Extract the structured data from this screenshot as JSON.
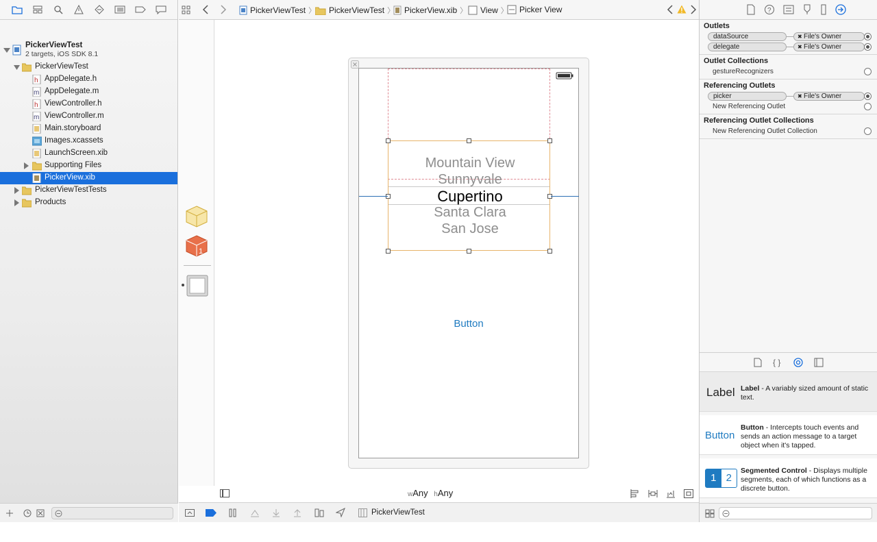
{
  "navigator": {
    "project_name": "PickerViewTest",
    "project_subtitle": "2 targets, iOS SDK 8.1",
    "items": [
      {
        "label": "PickerViewTest"
      },
      {
        "label": "AppDelegate.h"
      },
      {
        "label": "AppDelegate.m"
      },
      {
        "label": "ViewController.h"
      },
      {
        "label": "ViewController.m"
      },
      {
        "label": "Main.storyboard"
      },
      {
        "label": "Images.xcassets"
      },
      {
        "label": "LaunchScreen.xib"
      },
      {
        "label": "Supporting Files"
      },
      {
        "label": "PickerView.xib"
      },
      {
        "label": "PickerViewTestTests"
      },
      {
        "label": "Products"
      }
    ]
  },
  "jumpbar": {
    "crumbs": [
      "PickerViewTest",
      "PickerViewTest",
      "PickerView.xib",
      "View",
      "Picker View"
    ]
  },
  "canvas": {
    "picker_rows": [
      "Mountain View",
      "Sunnyvale",
      "Cupertino",
      "Santa Clara",
      "San Jose"
    ],
    "button_label": "Button",
    "size_class_w_prefix": "w",
    "size_class_w": "Any",
    "size_class_h_prefix": "h",
    "size_class_h": "Any",
    "selected_index": 2
  },
  "debug": {
    "scheme_label": "PickerViewTest"
  },
  "inspector": {
    "outlets_title": "Outlets",
    "outlets": [
      {
        "name": "dataSource",
        "target": "File's Owner"
      },
      {
        "name": "delegate",
        "target": "File's Owner"
      }
    ],
    "outlet_collections_title": "Outlet Collections",
    "outlet_collections": [
      {
        "name": "gestureRecognizers"
      }
    ],
    "referencing_outlets_title": "Referencing Outlets",
    "referencing_outlets": [
      {
        "name": "picker",
        "target": "File's Owner"
      }
    ],
    "new_referencing_outlet": "New Referencing Outlet",
    "referencing_collections_title": "Referencing Outlet Collections",
    "new_referencing_collection": "New Referencing Outlet Collection"
  },
  "library": {
    "items": [
      {
        "big": "Label",
        "title": "Label",
        "desc": " - A variably sized amount of static text."
      },
      {
        "big": "Button",
        "title": "Button",
        "desc": " - Intercepts touch events and sends an action message to a target object when it's tapped."
      },
      {
        "title": "Segmented Control",
        "desc": " - Displays multiple segments, each of which functions as a discrete button.",
        "seg1": "1",
        "seg2": "2"
      }
    ]
  },
  "colors": {
    "accent": "#1a6fdc",
    "button_text": "#1f7bc1",
    "selection_orange": "#e8b46a"
  }
}
